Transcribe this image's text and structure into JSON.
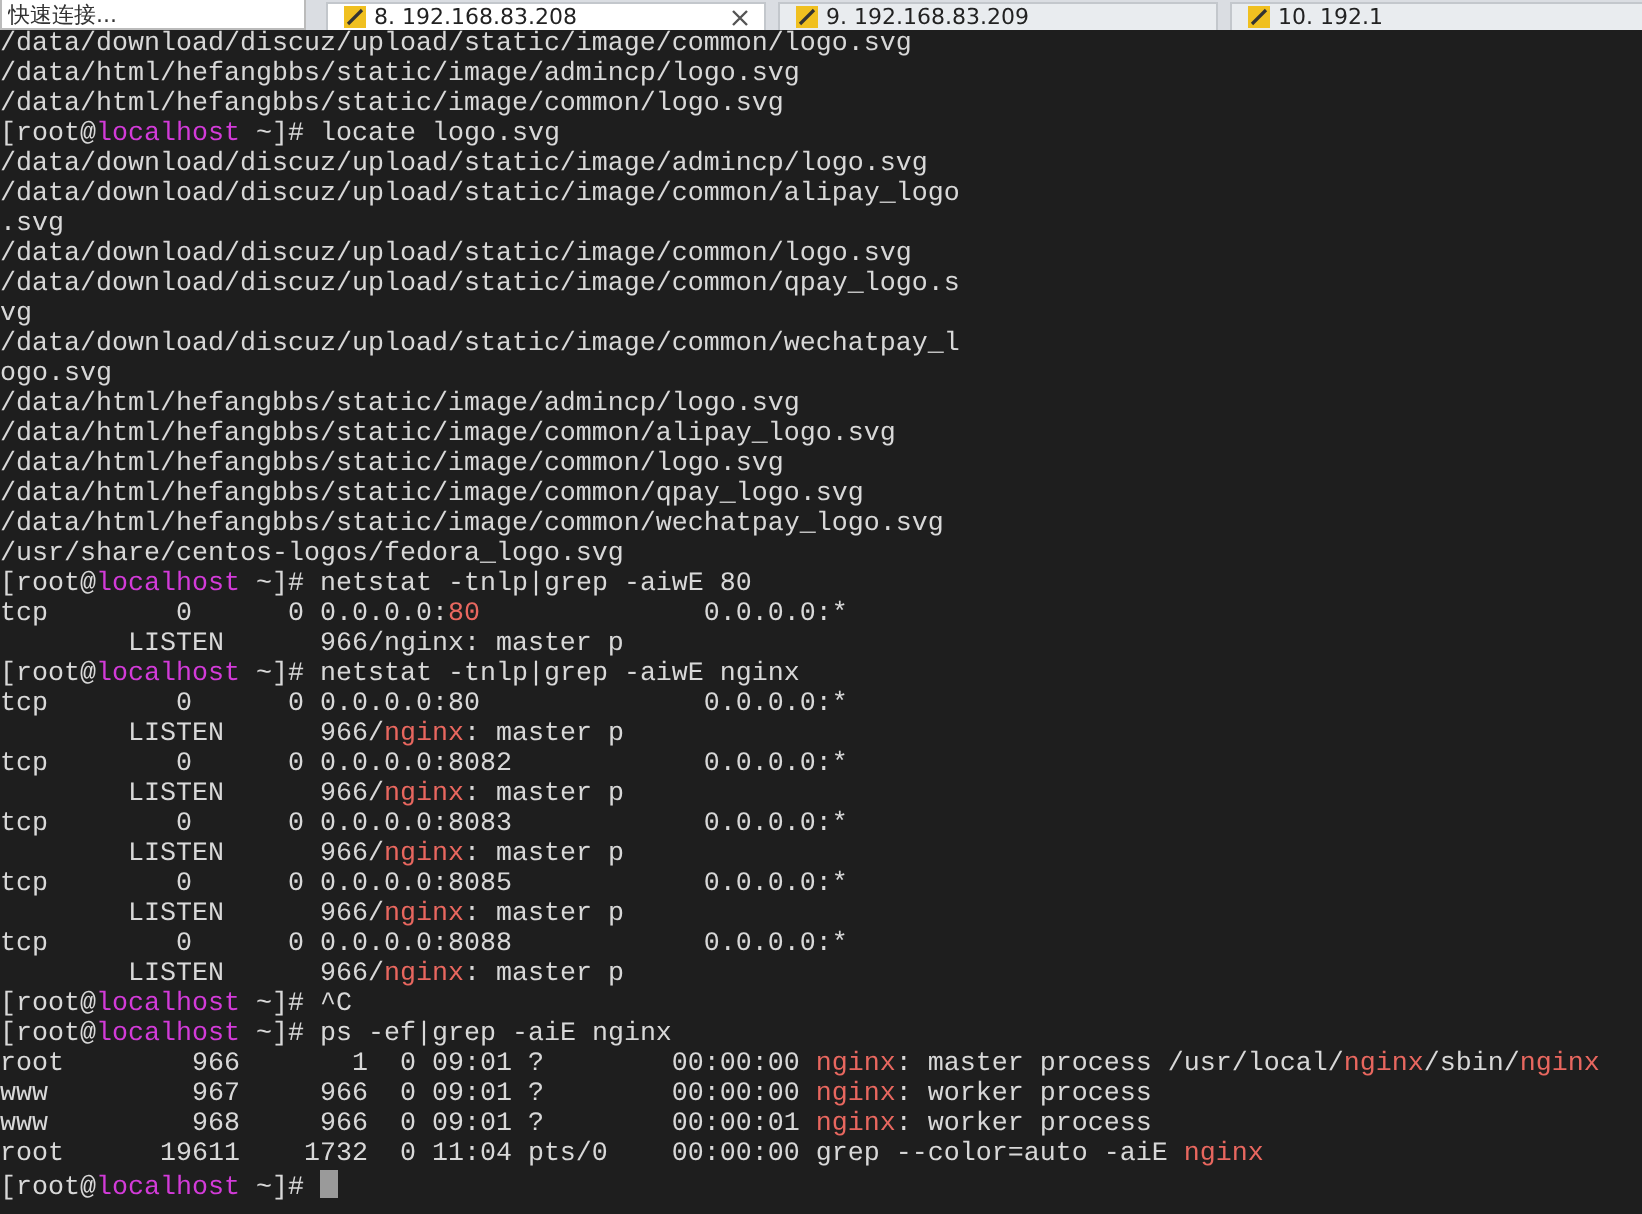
{
  "toolbar": {
    "quick_connect": "快速连接..."
  },
  "tabs": [
    {
      "label": "8. 192.168.83.208",
      "selected": true
    },
    {
      "label": "9. 192.168.83.209",
      "selected": false
    },
    {
      "label": "10. 192.1",
      "selected": false
    }
  ],
  "terminal": {
    "lines": [
      {
        "segments": [
          {
            "kind": "text",
            "text": "/data/download/discuz/upload/static/image/common/logo.svg"
          }
        ]
      },
      {
        "segments": [
          {
            "kind": "text",
            "text": "/data/html/hefangbbs/static/image/admincp/logo.svg"
          }
        ]
      },
      {
        "segments": [
          {
            "kind": "text",
            "text": "/data/html/hefangbbs/static/image/common/logo.svg"
          }
        ]
      },
      {
        "segments": [
          {
            "kind": "text",
            "text": "[root@"
          },
          {
            "kind": "host",
            "text": "localhost"
          },
          {
            "kind": "text",
            "text": " ~]# locate logo.svg"
          }
        ]
      },
      {
        "segments": [
          {
            "kind": "text",
            "text": "/data/download/discuz/upload/static/image/admincp/logo.svg"
          }
        ]
      },
      {
        "segments": [
          {
            "kind": "text",
            "text": "/data/download/discuz/upload/static/image/common/alipay_logo"
          }
        ]
      },
      {
        "segments": [
          {
            "kind": "text",
            "text": ".svg"
          }
        ]
      },
      {
        "segments": [
          {
            "kind": "text",
            "text": "/data/download/discuz/upload/static/image/common/logo.svg"
          }
        ]
      },
      {
        "segments": [
          {
            "kind": "text",
            "text": "/data/download/discuz/upload/static/image/common/qpay_logo.s"
          }
        ]
      },
      {
        "segments": [
          {
            "kind": "text",
            "text": "vg"
          }
        ]
      },
      {
        "segments": [
          {
            "kind": "text",
            "text": "/data/download/discuz/upload/static/image/common/wechatpay_l"
          }
        ]
      },
      {
        "segments": [
          {
            "kind": "text",
            "text": "ogo.svg"
          }
        ]
      },
      {
        "segments": [
          {
            "kind": "text",
            "text": "/data/html/hefangbbs/static/image/admincp/logo.svg"
          }
        ]
      },
      {
        "segments": [
          {
            "kind": "text",
            "text": "/data/html/hefangbbs/static/image/common/alipay_logo.svg"
          }
        ]
      },
      {
        "segments": [
          {
            "kind": "text",
            "text": "/data/html/hefangbbs/static/image/common/logo.svg"
          }
        ]
      },
      {
        "segments": [
          {
            "kind": "text",
            "text": "/data/html/hefangbbs/static/image/common/qpay_logo.svg"
          }
        ]
      },
      {
        "segments": [
          {
            "kind": "text",
            "text": "/data/html/hefangbbs/static/image/common/wechatpay_logo.svg"
          }
        ]
      },
      {
        "segments": [
          {
            "kind": "text",
            "text": "/usr/share/centos-logos/fedora_logo.svg"
          }
        ]
      },
      {
        "segments": [
          {
            "kind": "text",
            "text": "[root@"
          },
          {
            "kind": "host",
            "text": "localhost"
          },
          {
            "kind": "text",
            "text": " ~]# netstat -tnlp|grep -aiwE 80"
          }
        ]
      },
      {
        "segments": [
          {
            "kind": "text",
            "text": "tcp        0      0 0.0.0.0:"
          },
          {
            "kind": "match",
            "text": "80"
          },
          {
            "kind": "text",
            "text": "              0.0.0.0:*"
          }
        ]
      },
      {
        "segments": [
          {
            "kind": "text",
            "text": "        LISTEN      966/nginx: master p"
          }
        ]
      },
      {
        "segments": [
          {
            "kind": "text",
            "text": "[root@"
          },
          {
            "kind": "host",
            "text": "localhost"
          },
          {
            "kind": "text",
            "text": " ~]# netstat -tnlp|grep -aiwE nginx"
          }
        ]
      },
      {
        "segments": [
          {
            "kind": "text",
            "text": "tcp        0      0 0.0.0.0:80              0.0.0.0:*"
          }
        ]
      },
      {
        "segments": [
          {
            "kind": "text",
            "text": "        LISTEN      966/"
          },
          {
            "kind": "match",
            "text": "nginx"
          },
          {
            "kind": "text",
            "text": ": master p"
          }
        ]
      },
      {
        "segments": [
          {
            "kind": "text",
            "text": "tcp        0      0 0.0.0.0:8082            0.0.0.0:*"
          }
        ]
      },
      {
        "segments": [
          {
            "kind": "text",
            "text": "        LISTEN      966/"
          },
          {
            "kind": "match",
            "text": "nginx"
          },
          {
            "kind": "text",
            "text": ": master p"
          }
        ]
      },
      {
        "segments": [
          {
            "kind": "text",
            "text": "tcp        0      0 0.0.0.0:8083            0.0.0.0:*"
          }
        ]
      },
      {
        "segments": [
          {
            "kind": "text",
            "text": "        LISTEN      966/"
          },
          {
            "kind": "match",
            "text": "nginx"
          },
          {
            "kind": "text",
            "text": ": master p"
          }
        ]
      },
      {
        "segments": [
          {
            "kind": "text",
            "text": "tcp        0      0 0.0.0.0:8085            0.0.0.0:*"
          }
        ]
      },
      {
        "segments": [
          {
            "kind": "text",
            "text": "        LISTEN      966/"
          },
          {
            "kind": "match",
            "text": "nginx"
          },
          {
            "kind": "text",
            "text": ": master p"
          }
        ]
      },
      {
        "segments": [
          {
            "kind": "text",
            "text": "tcp        0      0 0.0.0.0:8088            0.0.0.0:*"
          }
        ]
      },
      {
        "segments": [
          {
            "kind": "text",
            "text": "        LISTEN      966/"
          },
          {
            "kind": "match",
            "text": "nginx"
          },
          {
            "kind": "text",
            "text": ": master p"
          }
        ]
      },
      {
        "segments": [
          {
            "kind": "text",
            "text": "[root@"
          },
          {
            "kind": "host",
            "text": "localhost"
          },
          {
            "kind": "text",
            "text": " ~]# ^C"
          }
        ]
      },
      {
        "segments": [
          {
            "kind": "text",
            "text": "[root@"
          },
          {
            "kind": "host",
            "text": "localhost"
          },
          {
            "kind": "text",
            "text": " ~]# ps -ef|grep -aiE nginx"
          }
        ]
      },
      {
        "segments": [
          {
            "kind": "text",
            "text": "root        966       1  0 09:01 ?        00:00:00 "
          },
          {
            "kind": "match",
            "text": "nginx"
          },
          {
            "kind": "text",
            "text": ": master process /usr/local/"
          },
          {
            "kind": "match",
            "text": "nginx"
          },
          {
            "kind": "text",
            "text": "/sbin/"
          },
          {
            "kind": "match",
            "text": "nginx"
          }
        ]
      },
      {
        "segments": [
          {
            "kind": "text",
            "text": "www         967     966  0 09:01 ?        00:00:00 "
          },
          {
            "kind": "match",
            "text": "nginx"
          },
          {
            "kind": "text",
            "text": ": worker process"
          }
        ]
      },
      {
        "segments": [
          {
            "kind": "text",
            "text": "www         968     966  0 09:01 ?        00:00:01 "
          },
          {
            "kind": "match",
            "text": "nginx"
          },
          {
            "kind": "text",
            "text": ": worker process"
          }
        ]
      },
      {
        "segments": [
          {
            "kind": "text",
            "text": "root      19611    1732  0 11:04 pts/0    00:00:00 grep --color=auto -aiE "
          },
          {
            "kind": "match",
            "text": "nginx"
          }
        ]
      },
      {
        "segments": [
          {
            "kind": "text",
            "text": "[root@"
          },
          {
            "kind": "host",
            "text": "localhost"
          },
          {
            "kind": "text",
            "text": " ~]# "
          }
        ],
        "cursor": true
      }
    ]
  }
}
